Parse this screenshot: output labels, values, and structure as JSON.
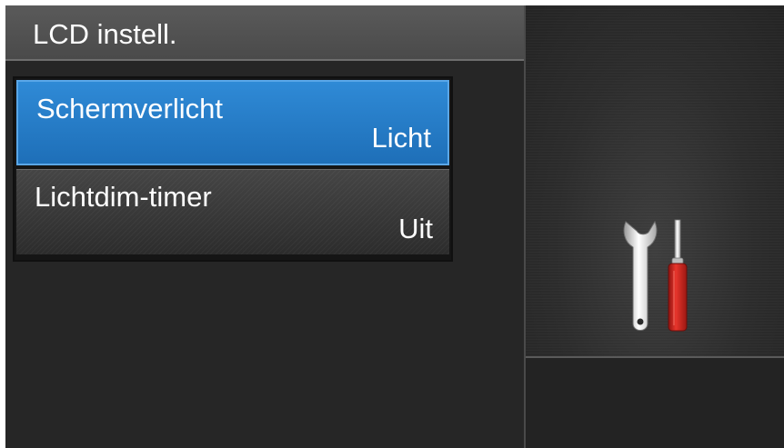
{
  "header": {
    "title": "LCD instell."
  },
  "menu": {
    "items": [
      {
        "label": "Schermverlicht",
        "value": "Licht",
        "selected": true
      },
      {
        "label": "Lichtdim-timer",
        "value": "Uit",
        "selected": false
      }
    ]
  },
  "icons": {
    "settings": "tools-icon"
  },
  "colors": {
    "selected_item": "#1e6fb8",
    "screwdriver_handle": "#d0231f",
    "background": "#232323"
  }
}
